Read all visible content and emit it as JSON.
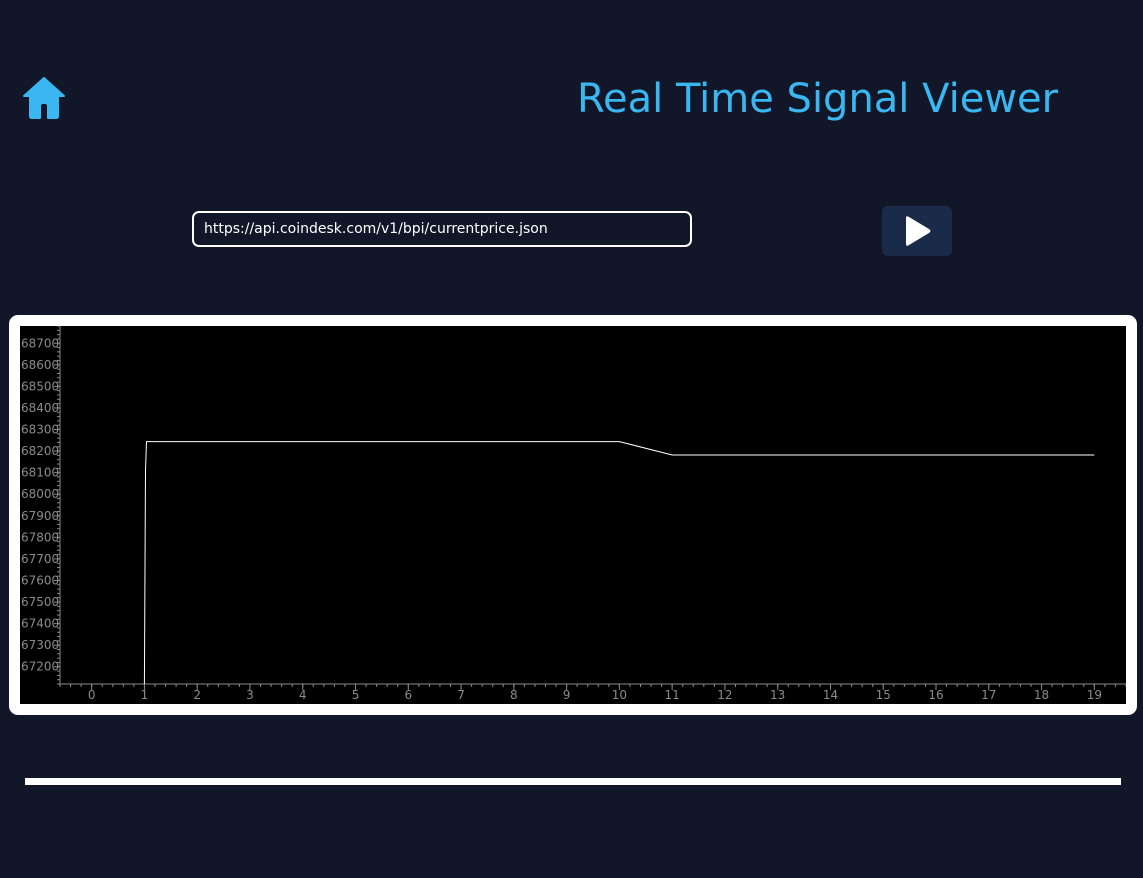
{
  "header": {
    "home_icon": "home-icon",
    "title": "Real Time Signal Viewer"
  },
  "toolbar": {
    "url_value": "https://api.coindesk.com/v1/bpi/currentprice.json",
    "play_icon": "play-icon"
  },
  "colors": {
    "background": "#111729",
    "accent": "#3ab7f0",
    "play_button": "#1a2b4a",
    "plot_bg": "#000000",
    "axis": "#8a8a8a",
    "trace": "#ffffff"
  },
  "chart_data": {
    "type": "line",
    "x_ticks": [
      0,
      1,
      2,
      3,
      4,
      5,
      6,
      7,
      8,
      9,
      10,
      11,
      12,
      13,
      14,
      15,
      16,
      17,
      18,
      19
    ],
    "y_ticks": [
      67200,
      67300,
      67400,
      67500,
      67600,
      67700,
      67800,
      67900,
      68000,
      68100,
      68200,
      68300,
      68400,
      68500,
      68600,
      68700
    ],
    "xlim": [
      -0.6,
      19.6
    ],
    "ylim": [
      67120,
      68780
    ],
    "series": [
      {
        "x": [
          1.0,
          1.02,
          1.02,
          1.04,
          2,
          3,
          4,
          5,
          6,
          7,
          8,
          9,
          10,
          11,
          12,
          13,
          14,
          15,
          16,
          17,
          18,
          19
        ],
        "y": [
          67120,
          68110,
          68110,
          68244,
          68244,
          68244,
          68244,
          68244,
          68244,
          68244,
          68244,
          68244,
          68244,
          68182,
          68182,
          68182,
          68182,
          68182,
          68182,
          68182,
          68182,
          68182
        ]
      }
    ],
    "grid": false
  }
}
